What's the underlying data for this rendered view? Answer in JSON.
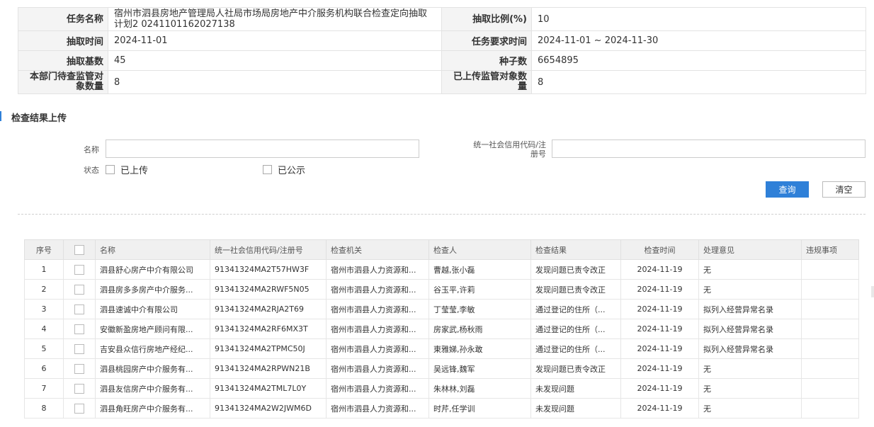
{
  "info": {
    "task_name_label": "任务名称",
    "task_name_value": "宿州市泗县房地产管理局人社局市场局房地产中介服务机构联合检查定向抽取计划2 0241101162027138",
    "ratio_label": "抽取比例(%)",
    "ratio_value": "10",
    "draw_time_label": "抽取时间",
    "draw_time_value": "2024-11-01",
    "required_time_label": "任务要求时间",
    "required_time_value": "2024-11-01 ~ 2024-11-30",
    "base_count_label": "抽取基数",
    "base_count_value": "45",
    "seed_label": "种子数",
    "seed_value": "6654895",
    "pending_label": "本部门待查监管对 象数量",
    "pending_value": "8",
    "uploaded_label": "已上传监管对象数 量",
    "uploaded_value": "8"
  },
  "section_title": "检查结果上传",
  "search": {
    "name_label": "名称",
    "name_value": "",
    "credit_label": "统一社会信用代码/注 册号",
    "credit_value": "",
    "status_label": "状态",
    "status_uploaded": "已上传",
    "status_published": "已公示",
    "query_button": "查询",
    "clear_button": "清空"
  },
  "colors": {
    "primary": "#2f80d8",
    "header_bg": "#f0f0f0",
    "label_bg": "#f4f4f4"
  },
  "table": {
    "columns": [
      "序号",
      "",
      "名称",
      "统一社会信用代码/注册号",
      "检查机关",
      "检查人",
      "检查结果",
      "检查时间",
      "处理意见",
      "违规事项"
    ],
    "rows": [
      [
        "1",
        "泗县舒心房产中介有限公司",
        "91341324MA2T57HW3F",
        "宿州市泗县人力资源和...",
        "曹越,张小磊",
        "发现问题已责令改正",
        "2024-11-19",
        "无",
        ""
      ],
      [
        "2",
        "泗县房多多房产中介服务...",
        "91341324MA2RWF5N05",
        "宿州市泗县人力资源和...",
        "谷玉平,许莉",
        "发现问题已责令改正",
        "2024-11-19",
        "无",
        ""
      ],
      [
        "3",
        "泗县速诚中介有限公司",
        "91341324MA2RJA2T69",
        "宿州市泗县人力资源和...",
        "丁莹莹,李敏",
        "通过登记的住所（...",
        "2024-11-19",
        "拟列入经营异常名录",
        ""
      ],
      [
        "4",
        "安徽新盈房地产顾问有限...",
        "91341324MA2RF6MX3T",
        "宿州市泗县人力资源和...",
        "房家武,杨秋雨",
        "通过登记的住所（...",
        "2024-11-19",
        "拟列入经营异常名录",
        ""
      ],
      [
        "5",
        "吉安县众信行房地产经纪...",
        "91341324MA2TPMC50J",
        "宿州市泗县人力资源和...",
        "東雅娣,孙永敢",
        "通过登记的住所（...",
        "2024-11-19",
        "拟列入经营异常名录",
        ""
      ],
      [
        "6",
        "泗县桃园房产中介服务有...",
        "91341324MA2RPWN21B",
        "宿州市泗县人力资源和...",
        "吴远锋,魏军",
        "发现问题已责令改正",
        "2024-11-19",
        "无",
        ""
      ],
      [
        "7",
        "泗县友信房产中介服务有...",
        "91341324MA2TML7L0Y",
        "宿州市泗县人力资源和...",
        "朱林林,刘磊",
        "未发现问题",
        "2024-11-19",
        "无",
        ""
      ],
      [
        "8",
        "泗县角旺房产中介服务有...",
        "91341324MA2W2JWM6D",
        "宿州市泗县人力资源和...",
        "时芹,任学训",
        "未发现问题",
        "2024-11-19",
        "无",
        ""
      ]
    ]
  }
}
